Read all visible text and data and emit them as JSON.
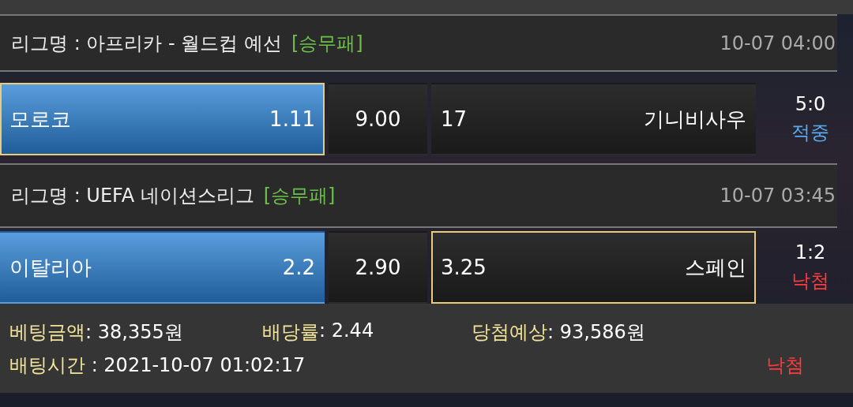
{
  "games": [
    {
      "league_label": "리그명 : 아프리카 - 월드컵 예선",
      "market": "[승무패]",
      "time": "10-07 04:00",
      "home": {
        "name": "모로코",
        "odds": "1.11",
        "highlighted": true,
        "selected": true
      },
      "draw": {
        "odds": "9.00",
        "highlighted": false,
        "selected": false
      },
      "away": {
        "odds": "17",
        "name": "기니비사우",
        "highlighted": false,
        "selected": false
      },
      "score": "5:0",
      "result": {
        "kind": "win",
        "text": "적중"
      }
    },
    {
      "league_label": "리그명 : UEFA 네이션스리그",
      "market": "[승무패]",
      "time": "10-07 03:45",
      "home": {
        "name": "이탈리아",
        "odds": "2.2",
        "highlighted": true,
        "selected": false
      },
      "draw": {
        "odds": "2.90",
        "highlighted": false,
        "selected": false
      },
      "away": {
        "odds": "3.25",
        "name": "스페인",
        "highlighted": false,
        "selected": true
      },
      "score": "1:2",
      "result": {
        "kind": "lose",
        "text": "낙첨"
      }
    }
  ],
  "summary": {
    "items": [
      {
        "label": "베팅금액",
        "value": ": 38,355원"
      },
      {
        "label": "배당률",
        "value": ": 2.44"
      },
      {
        "label": "당첨예상",
        "value": ": 93,586원"
      }
    ],
    "time_label": "배팅시간",
    "time_value": " : 2021-10-07 01:02:17",
    "result": {
      "kind": "lose",
      "text": "낙첨"
    }
  }
}
